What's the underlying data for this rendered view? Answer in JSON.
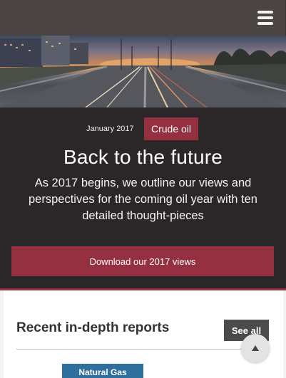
{
  "header": {
    "menu_icon": "hamburger-menu-icon"
  },
  "hero": {
    "image_icon": "highway-at-sunset-photo",
    "date": "January 2017",
    "tag": "Crude oil",
    "title": "Back to the future",
    "description": "As 2017 begins, we outline our views and perspectives for the coming oil year with ten detailed thought-pieces",
    "cta_label": "Download our 2017 views"
  },
  "reports": {
    "title": "Recent in-depth reports",
    "see_all_label": "See all",
    "scroll_top_icon": "arrow-up-icon",
    "items": [
      {
        "category": "Natural Gas"
      }
    ]
  },
  "colors": {
    "header_bg": "#4a4543",
    "panel_bg": "#2b2628",
    "accent": "#943040",
    "see_all_bg": "#4d4a4a",
    "category_blue": "#2e6f9e"
  }
}
